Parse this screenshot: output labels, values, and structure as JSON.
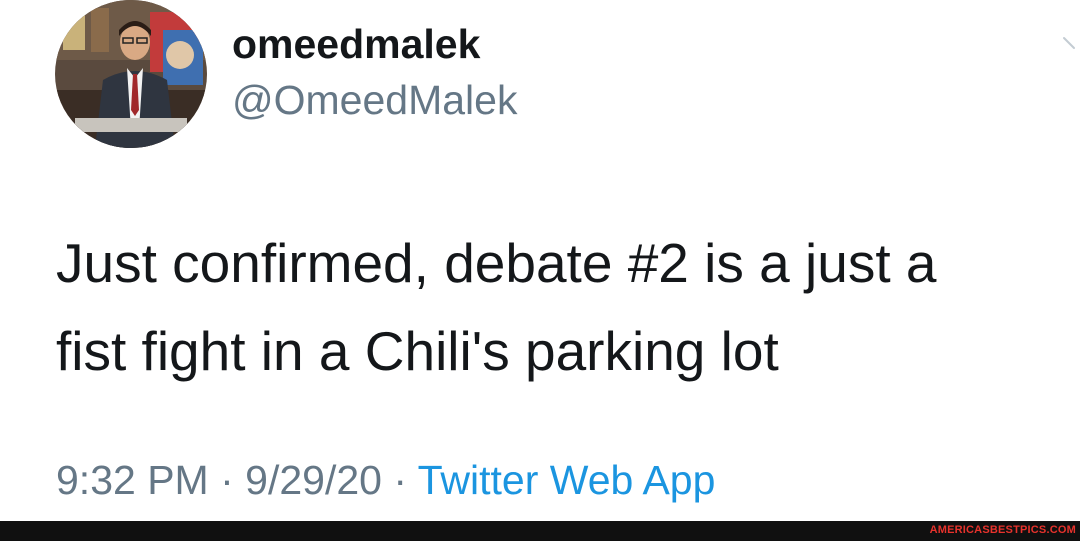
{
  "tweet": {
    "display_name": "omeedmalek",
    "handle": "@OmeedMalek",
    "text_line1": "Just confirmed, debate #2 is a just a",
    "text_line2": "fist fight in a Chili's parking lot",
    "time": "9:32 PM",
    "separator": " · ",
    "date": "9/29/20",
    "source": "Twitter Web App",
    "more_icon": "chevron-down-icon",
    "avatar_icon": "avatar"
  },
  "footer": {
    "watermark": "AMERICASBESTPICS.COM"
  },
  "colors": {
    "text": "#14171a",
    "secondary": "#657786",
    "link": "#1b95e0",
    "watermark": "#e8322c",
    "footer_bg": "#101010"
  }
}
